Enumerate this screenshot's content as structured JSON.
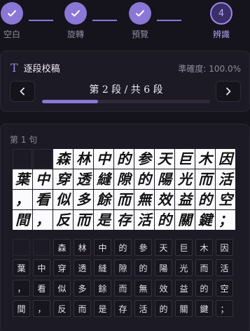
{
  "stepper": {
    "steps": [
      {
        "label": "空白",
        "status": "done"
      },
      {
        "label": "旋轉",
        "status": "done"
      },
      {
        "label": "預覽",
        "status": "done"
      },
      {
        "label": "辨識",
        "status": "active",
        "number": "4"
      }
    ]
  },
  "review": {
    "title": "逐段校稿",
    "accuracy": "準確度: 100.0%",
    "segment_label": "第 2 段 / 共 6 段",
    "progress_fraction": 0.333
  },
  "section": {
    "label": "第 1 句",
    "handwriting_cells": [
      "",
      "",
      "森",
      "林",
      "中",
      "的",
      "参",
      "天",
      "巨",
      "木",
      "因",
      "葉",
      "中",
      "穿",
      "透",
      "縫",
      "隙",
      "的",
      "陽",
      "光",
      "而",
      "活",
      "，",
      "看",
      "似",
      "多",
      "餘",
      "而",
      "無",
      "效",
      "益",
      "的",
      "空",
      "間",
      "，",
      "反",
      "而",
      "是",
      "存",
      "活",
      "的",
      "關",
      "鍵",
      "；"
    ],
    "ocr_cells": [
      "",
      "",
      "森",
      "林",
      "中",
      "的",
      "參",
      "天",
      "巨",
      "木",
      "因",
      "葉",
      "中",
      "穿",
      "透",
      "縫",
      "隙",
      "的",
      "陽",
      "光",
      "而",
      "活",
      "，",
      "看",
      "似",
      "多",
      "餘",
      "而",
      "無",
      "效",
      "益",
      "的",
      "空",
      "間",
      "，",
      "反",
      "而",
      "是",
      "存",
      "活",
      "的",
      "關",
      "鍵",
      "；"
    ]
  },
  "colors": {
    "accent": "#8a77d6",
    "background": "#15131c",
    "card": "#1c1a24"
  }
}
